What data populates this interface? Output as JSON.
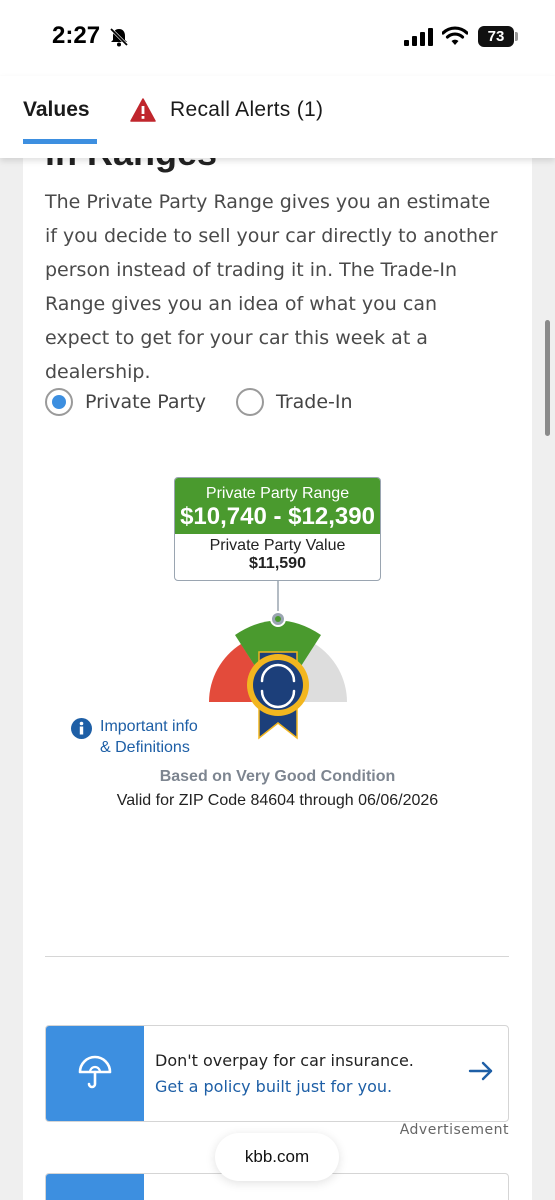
{
  "status": {
    "time": "2:27",
    "battery": "73"
  },
  "tabs": {
    "values": "Values",
    "recall": "Recall Alerts (1)"
  },
  "section": {
    "heading": "in Ranges",
    "description": "The Private Party Range gives you an estimate if you decide to sell your car directly to another person instead of trading it in. The Trade-In Range gives you an idea of what you can expect to get for your car this week at a dealership."
  },
  "options": {
    "private_party": "Private Party",
    "trade_in": "Trade-In",
    "selected": "Private Party"
  },
  "value_box": {
    "range_title": "Private Party Range",
    "range_value": "$10,740 - $12,390",
    "value_label": "Private Party Value",
    "value": "$11,590"
  },
  "gauge": {
    "colors": {
      "low": "#e34b3b",
      "mid": "#4a9a2e",
      "high": "#dddddd",
      "badge": "#1c3f7a",
      "seal": "#f2b61f"
    }
  },
  "info": {
    "line1": "Important info",
    "line2": "& Definitions"
  },
  "condition": "Based on Very Good Condition",
  "validity": "Valid for ZIP Code 84604 through 06/06/2026",
  "ad": {
    "line1": "Don't overpay for car insurance.",
    "line2": "Get a policy built just for you.",
    "label": "Advertisement",
    "icon": "umbrella-icon"
  },
  "browser": {
    "url": "kbb.com"
  },
  "colors": {
    "accent": "#3d8fe0",
    "green": "#4a9a2e",
    "link": "#1e5fa6",
    "alert": "#c0262d"
  }
}
